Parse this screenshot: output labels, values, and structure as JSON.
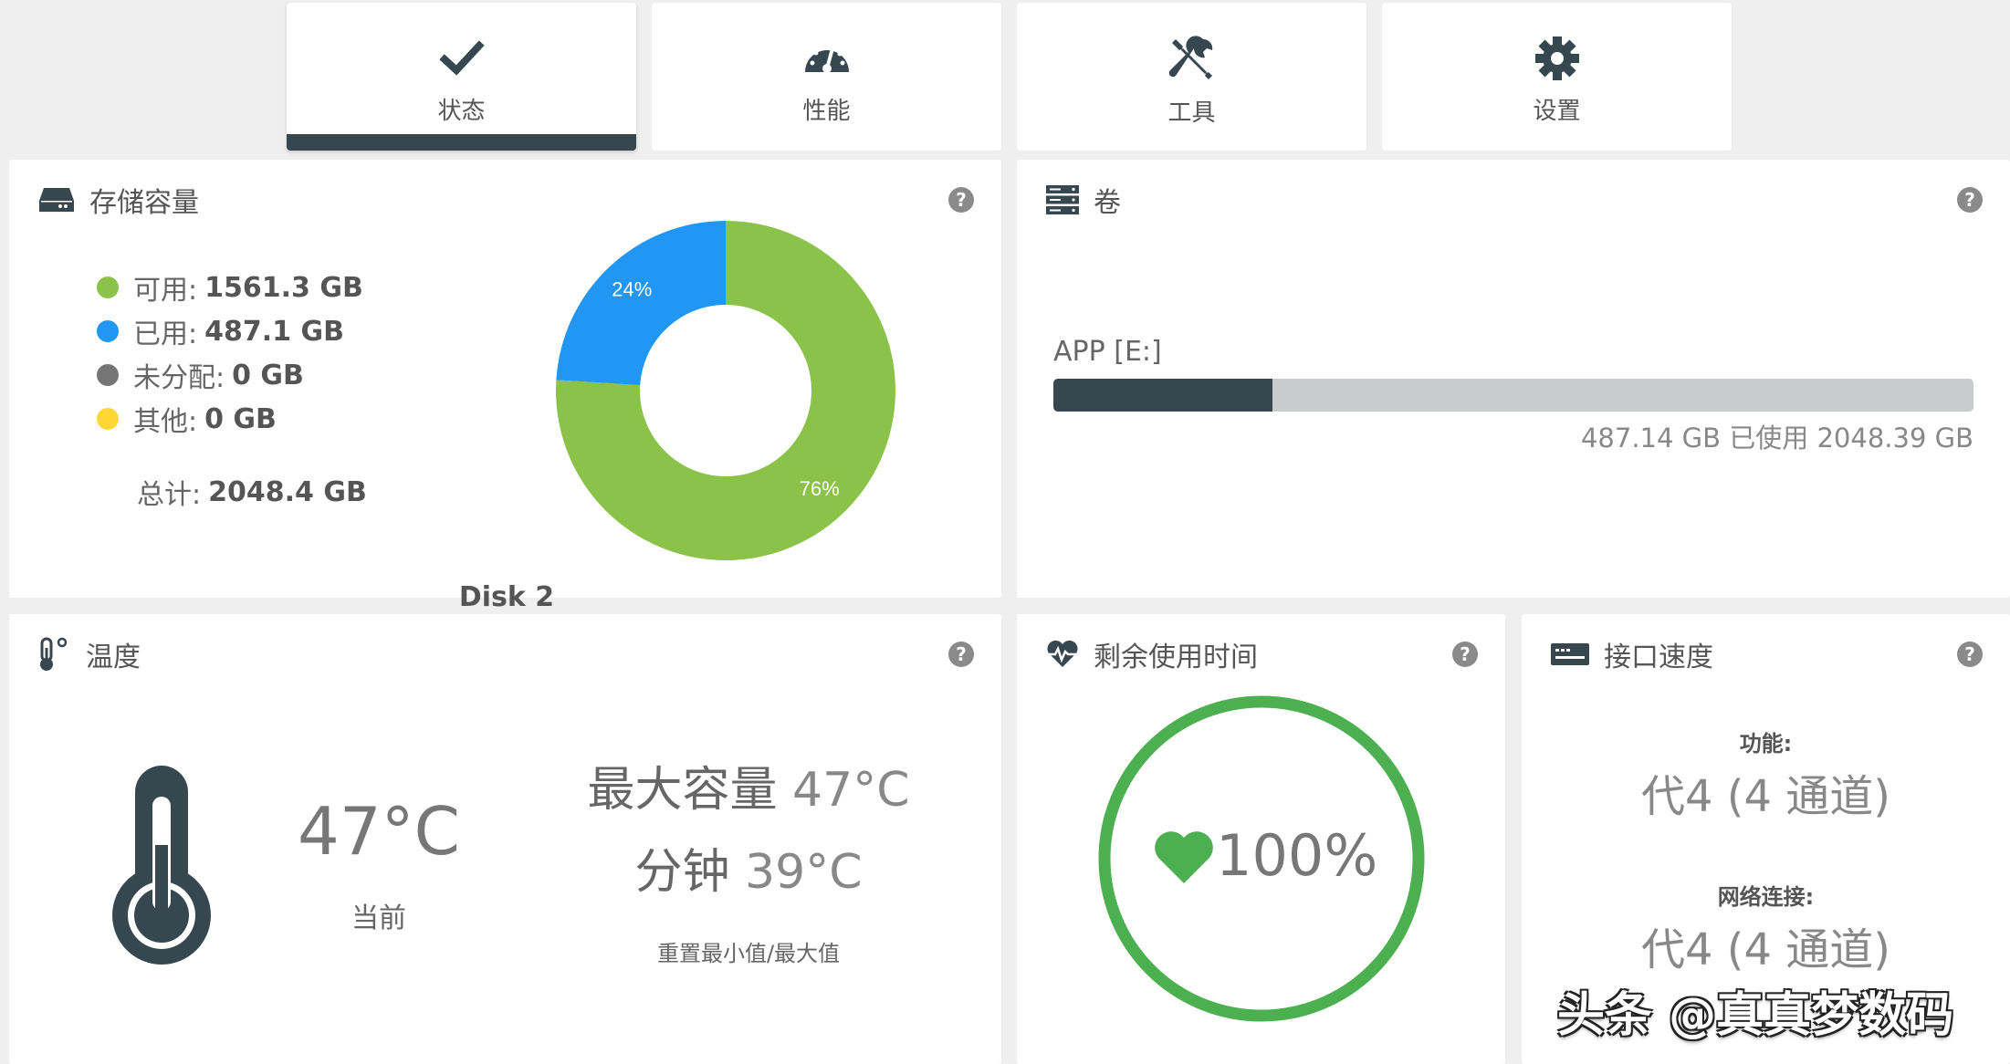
{
  "tabs": [
    {
      "label": "状态",
      "icon": "check-icon",
      "active": true
    },
    {
      "label": "性能",
      "icon": "speedometer-icon",
      "active": false
    },
    {
      "label": "工具",
      "icon": "tools-icon",
      "active": false
    },
    {
      "label": "设置",
      "icon": "gear-icon",
      "active": false
    }
  ],
  "storage": {
    "title": "存储容量",
    "legend": [
      {
        "label": "可用:",
        "value": "1561.3 GB",
        "color": "#8bc34a"
      },
      {
        "label": "已用:",
        "value": "487.1 GB",
        "color": "#2196f3"
      },
      {
        "label": "未分配:",
        "value": "0 GB",
        "color": "#757575"
      },
      {
        "label": "其他:",
        "value": "0 GB",
        "color": "#fdd835"
      }
    ],
    "total_label": "总计:",
    "total_value": "2048.4 GB",
    "disk_name": "Disk 2"
  },
  "chart_data": {
    "type": "pie",
    "categories": [
      "可用",
      "已用"
    ],
    "values": [
      76,
      24
    ],
    "labels": [
      "76%",
      "24%"
    ],
    "colors": [
      "#8bc34a",
      "#2196f3"
    ],
    "donut": true
  },
  "volumes": {
    "title": "卷",
    "name": "APP [E:]",
    "used_fraction": 0.2378,
    "usage_text": "487.14 GB 已使用 2048.39 GB"
  },
  "temperature": {
    "title": "温度",
    "current": "47°C",
    "current_label": "当前",
    "max_label": "最大容量",
    "max_value": "47°C",
    "min_label": "分钟",
    "min_value": "39°C",
    "reset_link": "重置最小值/最大值"
  },
  "lifetime": {
    "title": "剩余使用时间",
    "value": "100%",
    "accent": "#4caf50"
  },
  "interface": {
    "title": "接口速度",
    "capability_label": "功能:",
    "capability_value": "代4 (4 通道)",
    "link_label": "网络连接:",
    "link_value": "代4 (4 通道)"
  },
  "watermark": "头条 @真真梦数码"
}
